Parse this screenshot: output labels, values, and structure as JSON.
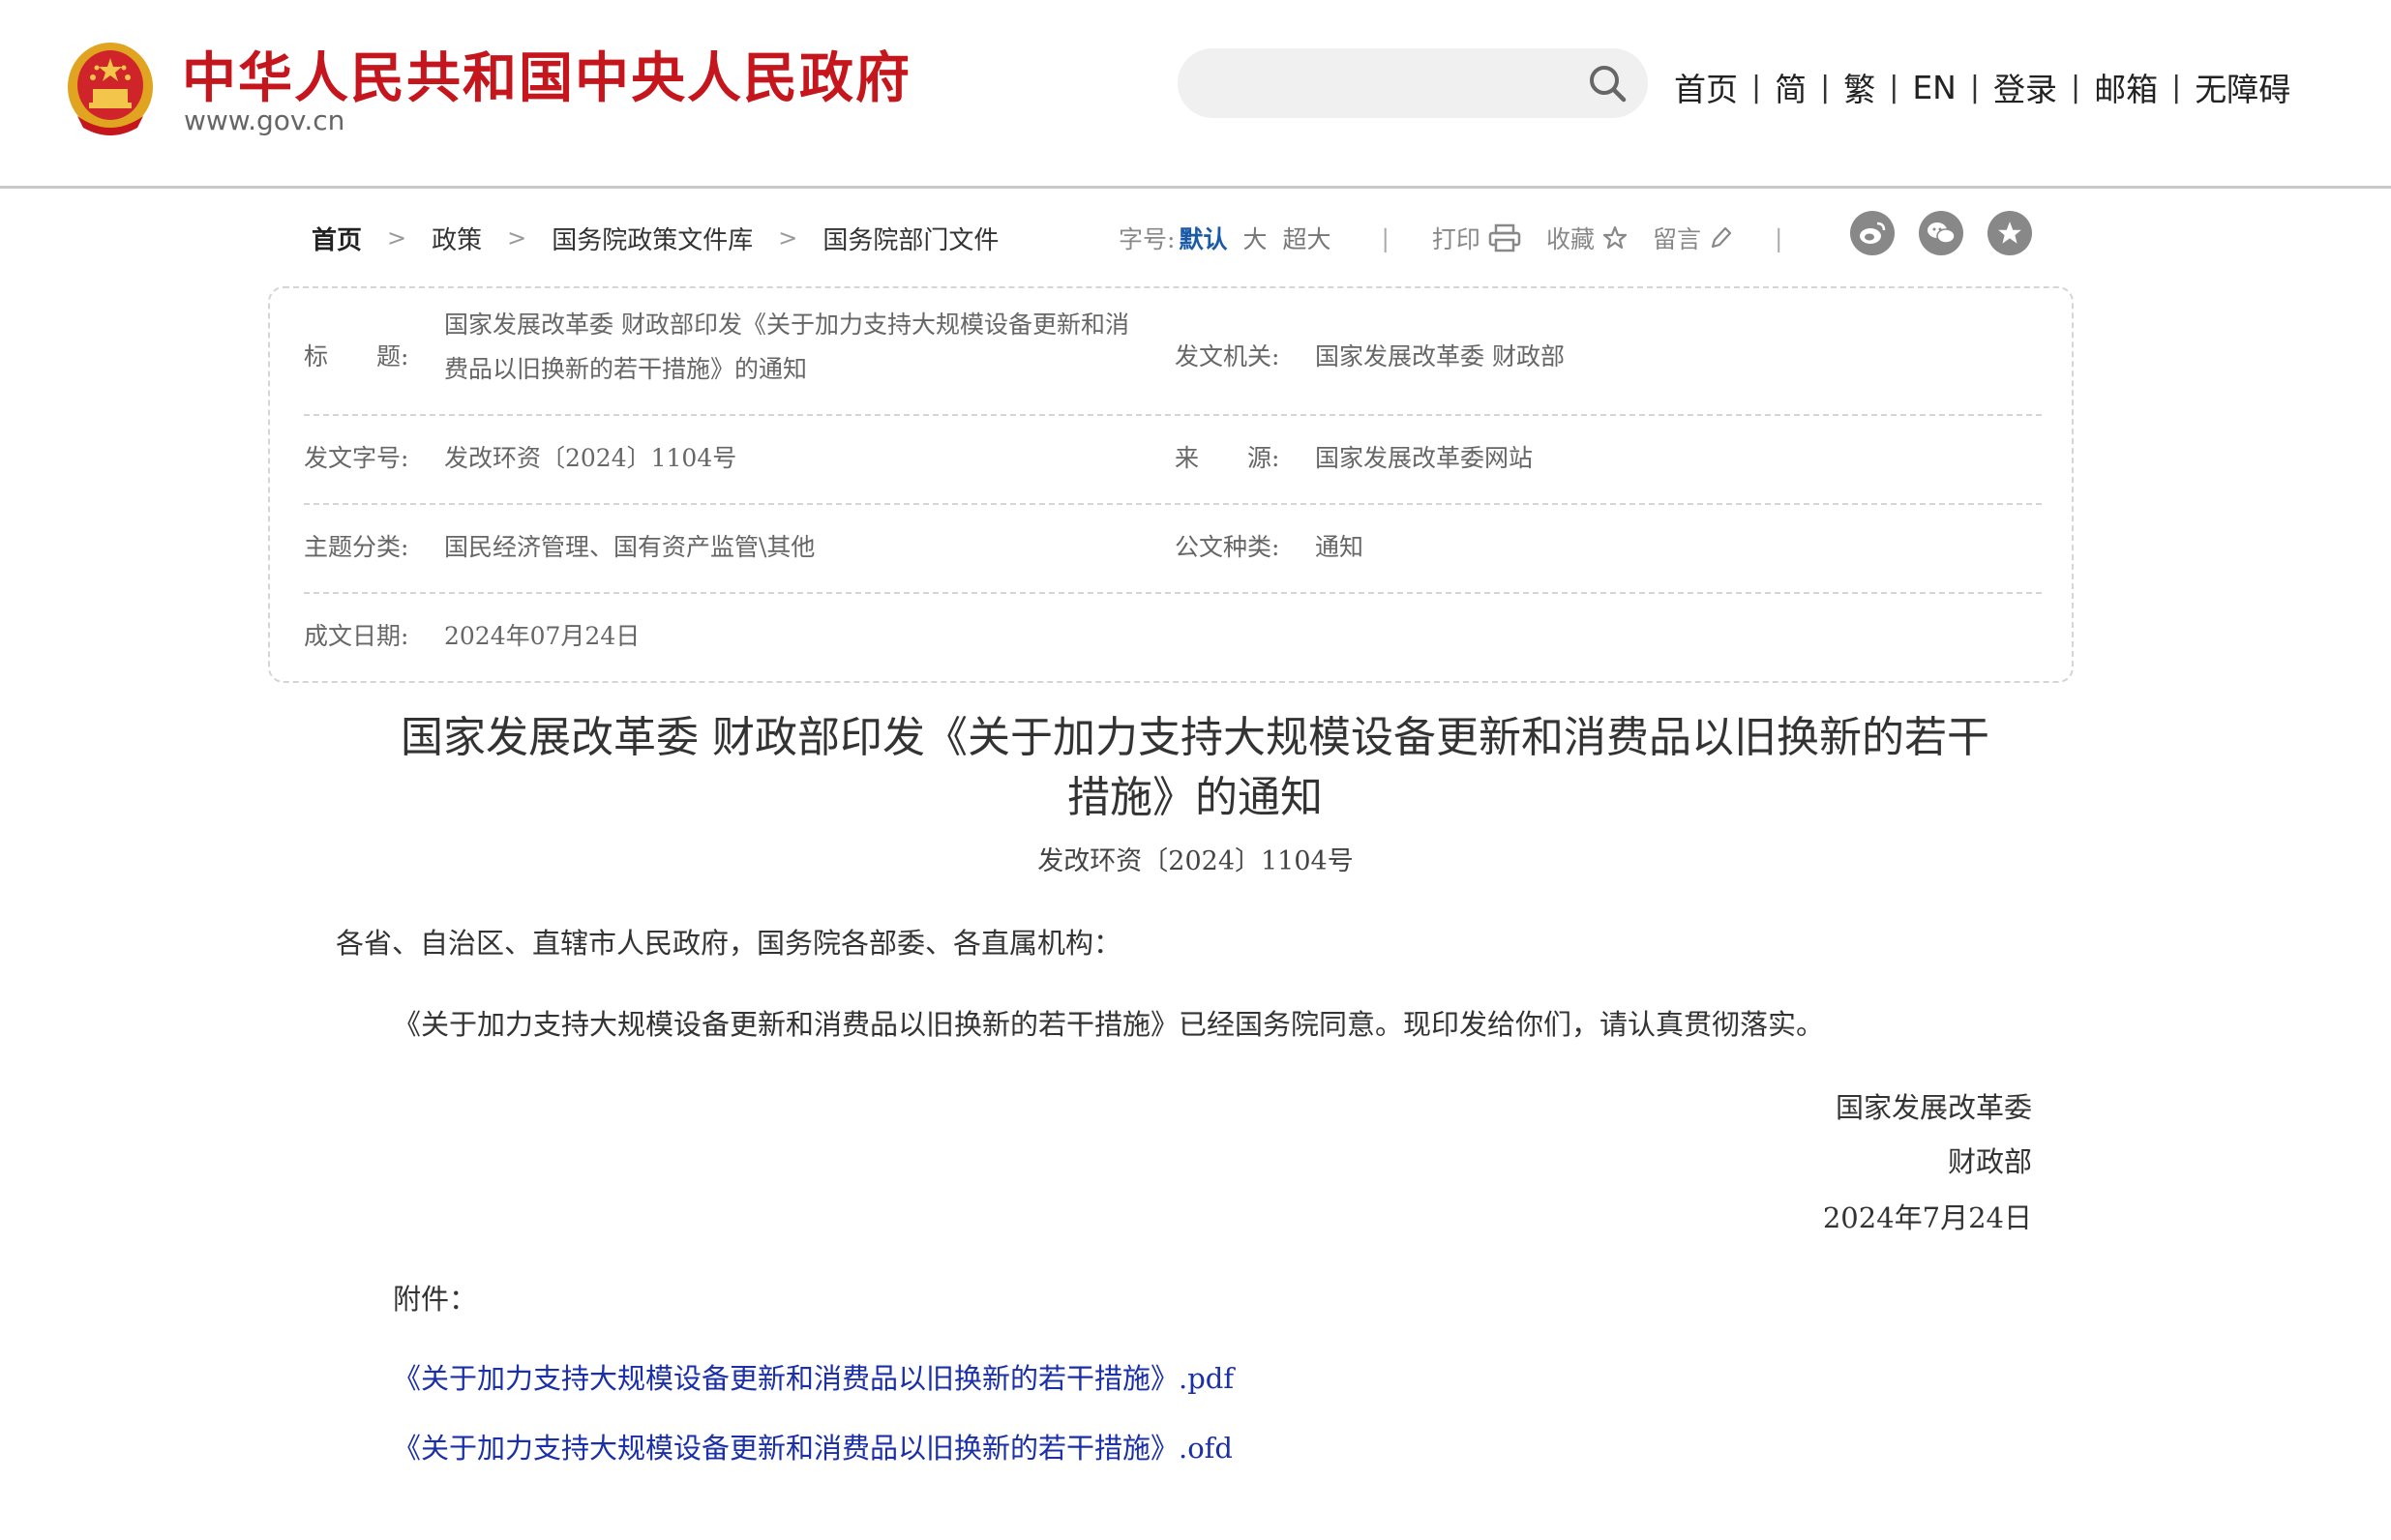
{
  "header": {
    "site_title": "中华人民共和国中央人民政府",
    "site_url": "www.gov.cn",
    "search": {
      "placeholder": "",
      "value": ""
    },
    "nav": [
      "首页",
      "简",
      "繁",
      "EN",
      "登录",
      "邮箱",
      "无障碍"
    ],
    "separator": "|"
  },
  "breadcrumb": [
    "首页",
    "政策",
    "国务院政策文件库",
    "国务院部门文件"
  ],
  "breadcrumb_separator": ">",
  "tools": {
    "font_size_label": "字号:",
    "font_sizes": [
      "默认",
      "大",
      "超大"
    ],
    "separator": "|",
    "print": "打印",
    "favorite": "收藏",
    "comment": "留言"
  },
  "share": [
    "weibo-icon",
    "wechat-icon",
    "star-icon"
  ],
  "info": {
    "title_label": "标　　题:",
    "title_value_line1": "国家发展改革委 财政部印发《关于加力支持大规模设备更新和消",
    "title_value_line2": "费品以旧换新的若干措施》的通知",
    "issuer_label": "发文机关:",
    "issuer_value": "国家发展改革委 财政部",
    "docno_label": "发文字号:",
    "docno_value": "发改环资〔2024〕1104号",
    "source_label": "来　　源:",
    "source_value": "国家发展改革委网站",
    "topic_label": "主题分类:",
    "topic_value": "国民经济管理、国有资产监管\\其他",
    "type_label": "公文种类:",
    "type_value": "通知",
    "date_label": "成文日期:",
    "date_value": "2024年07月24日"
  },
  "article": {
    "title_line1": "国家发展改革委 财政部印发《关于加力支持大规模设备更新和消费品以旧换新的若干",
    "title_line2": "措施》的通知",
    "doc_number": "发改环资〔2024〕1104号",
    "addressee": "各省、自治区、直辖市人民政府，国务院各部委、各直属机构：",
    "body": "《关于加力支持大规模设备更新和消费品以旧换新的若干措施》已经国务院同意。现印发给你们，请认真贯彻落实。",
    "signature": [
      "国家发展改革委",
      "财政部",
      "2024年7月24日"
    ],
    "attachments_label": "附件：",
    "attachments": [
      "《关于加力支持大规模设备更新和消费品以旧换新的若干措施》.pdf",
      "《关于加力支持大规模设备更新和消费品以旧换新的若干措施》.ofd"
    ]
  },
  "colors": {
    "brand_red": "#c4161c",
    "link_blue": "#1a2fa8",
    "active_blue": "#1a5aa8"
  }
}
